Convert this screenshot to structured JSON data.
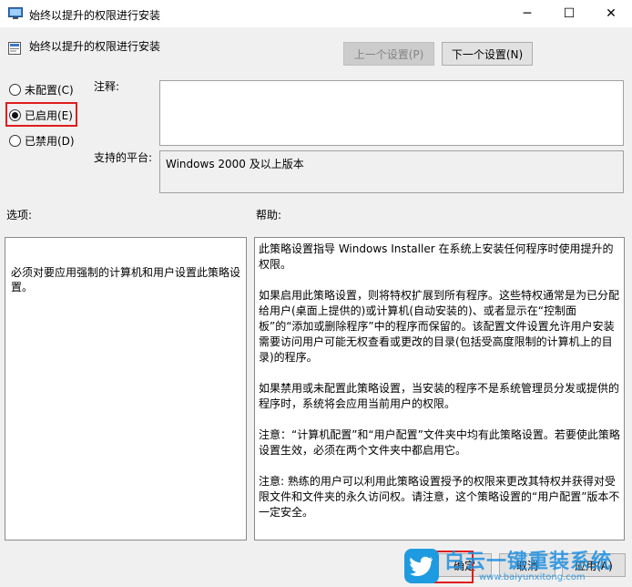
{
  "window": {
    "title": "始终以提升的权限进行安装",
    "minimize": "─",
    "maximize": "☐",
    "close": "✕"
  },
  "header": {
    "policy_name": "始终以提升的权限进行安装"
  },
  "nav": {
    "prev_label": "上一个设置(P)",
    "next_label": "下一个设置(N)"
  },
  "state": {
    "options": [
      {
        "label": "未配置(C)",
        "checked": false
      },
      {
        "label": "已启用(E)",
        "checked": true
      },
      {
        "label": "已禁用(D)",
        "checked": false
      }
    ]
  },
  "labels": {
    "comment": "注释:",
    "platform": "支持的平台:",
    "options": "选项:",
    "help": "帮助:"
  },
  "platform_value": "Windows 2000 及以上版本",
  "options_text": "必须对要应用强制的计算机和用户设置此策略设置。",
  "help": {
    "p1": "此策略设置指导 Windows Installer 在系统上安装任何程序时使用提升的权限。",
    "p2": "如果启用此策略设置，则将特权扩展到所有程序。这些特权通常是为已分配给用户(桌面上提供的)或计算机(自动安装的)、或者显示在“控制面板”的“添加或删除程序”中的程序而保留的。该配置文件设置允许用户安装需要访问用户可能无权查看或更改的目录(包括受高度限制的计算机上的目录)的程序。",
    "p3": "如果禁用或未配置此策略设置，当安装的程序不是系统管理员分发或提供的程序时，系统将会应用当前用户的权限。",
    "p4": "注意：“计算机配置”和“用户配置”文件夹中均有此策略设置。若要使此策略设置生效，必须在两个文件夹中都启用它。",
    "p5": "注意: 熟练的用户可以利用此策略设置授予的权限来更改其特权并获得对受限文件和文件夹的永久访问权。请注意，这个策略设置的“用户配置”版本不一定安全。"
  },
  "footer": {
    "ok_label": "确定",
    "cancel_label": "取消",
    "apply_label": "应用(A)"
  },
  "watermark": {
    "title": "白云一键重装系统",
    "url": "www.baiyunxitong.com"
  },
  "colors": {
    "highlight": "#e01c1c",
    "watermark": "#1e9be0"
  }
}
